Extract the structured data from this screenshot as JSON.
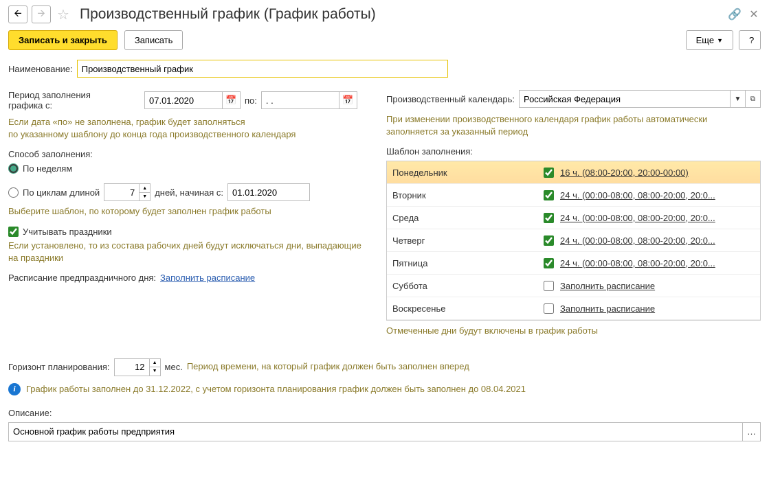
{
  "header": {
    "title": "Производственный график (График работы)"
  },
  "toolbar": {
    "save_close": "Записать и закрыть",
    "save": "Записать",
    "more": "Еще",
    "help": "?"
  },
  "labels": {
    "name": "Наименование:",
    "period_from": "Период заполнения графика с:",
    "period_to": "по:",
    "calendar": "Производственный календарь:",
    "fill_method": "Способ заполнения:",
    "by_weeks": "По неделям",
    "by_cycles": "По циклам длиной",
    "days_starting": "дней,  начиная с:",
    "template": "Шаблон заполнения:",
    "holidays": "Учитывать праздники",
    "preholiday": "Расписание предпраздничного дня:",
    "fill_schedule_link": "Заполнить расписание",
    "horizon": "Горизонт планирования:",
    "horizon_unit": "мес.",
    "horizon_hint": "Период времени, на который график должен быть заполнен вперед",
    "description": "Описание:"
  },
  "hints": {
    "period": "Если дата «по» не заполнена, график будет заполняться\nпо указанному шаблону до конца года производственного календаря",
    "calendar": "При изменении производственного календаря график работы автоматически заполняется за указанный период",
    "template_choice": "Выберите шаблон, по которому будет заполнен график работы",
    "holidays": "Если установлено, то из состава рабочих дней\nбудут исключаться дни, выпадающие на праздники",
    "template_footer": "Отмеченные дни будут включены в график работы",
    "info": "График работы заполнен до 31.12.2022, с учетом горизонта планирования график должен быть заполнен до 08.04.2021"
  },
  "values": {
    "name": "Производственный график",
    "date_from": "07.01.2020",
    "date_to": ". .",
    "calendar": "Российская Федерация",
    "cycle_days": "7",
    "cycle_start": "01.01.2020",
    "horizon": "12",
    "description": "Основной график работы предприятия"
  },
  "template_days": [
    {
      "name": "Понедельник",
      "checked": true,
      "schedule": "16 ч. (08:00-20:00, 20:00-00:00)",
      "selected": true
    },
    {
      "name": "Вторник",
      "checked": true,
      "schedule": "24 ч. (00:00-08:00, 08:00-20:00, 20:0..."
    },
    {
      "name": "Среда",
      "checked": true,
      "schedule": "24 ч. (00:00-08:00, 08:00-20:00, 20:0..."
    },
    {
      "name": "Четверг",
      "checked": true,
      "schedule": "24 ч. (00:00-08:00, 08:00-20:00, 20:0..."
    },
    {
      "name": "Пятница",
      "checked": true,
      "schedule": "24 ч. (00:00-08:00, 08:00-20:00, 20:0..."
    },
    {
      "name": "Суббота",
      "checked": false,
      "schedule": "Заполнить расписание"
    },
    {
      "name": "Воскресенье",
      "checked": false,
      "schedule": "Заполнить расписание"
    }
  ]
}
